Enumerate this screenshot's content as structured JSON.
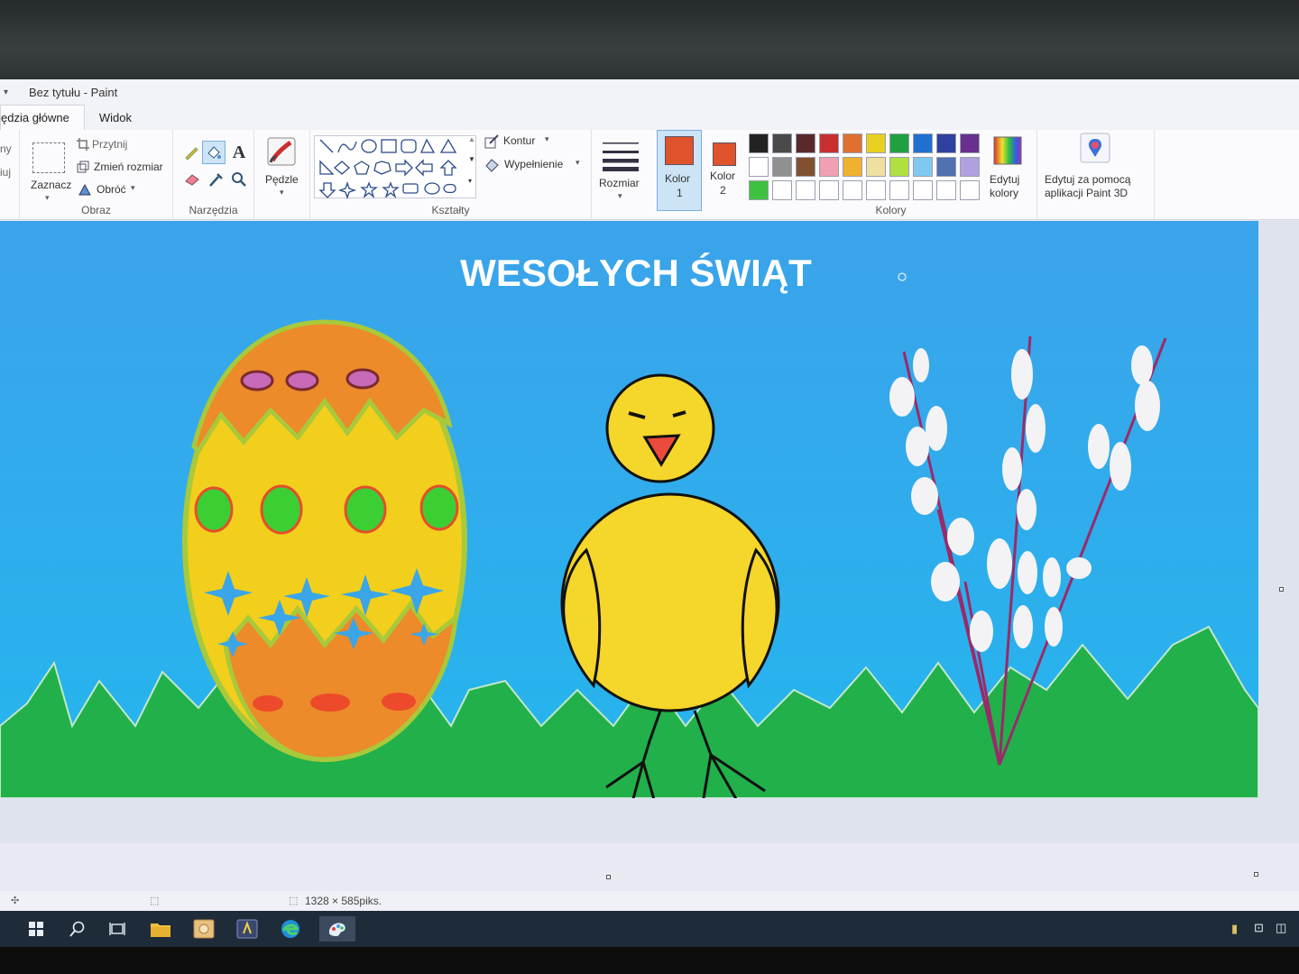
{
  "window": {
    "title": "Bez tytułu - Paint"
  },
  "tabs": [
    {
      "label": "ędzia główne"
    },
    {
      "label": "Widok"
    }
  ],
  "ribbon": {
    "left_partial": {
      "line1": "ny",
      "line2": "iuj"
    },
    "obraz": {
      "group_label": "Obraz",
      "select_label": "Zaznacz",
      "crop_label": "Przytnij",
      "resize_label": "Zmień rozmiar",
      "rotate_label": "Obróć"
    },
    "narzedzia": {
      "group_label": "Narzędzia",
      "text_tool_glyph": "A"
    },
    "brushes": {
      "label": "Pędzle"
    },
    "ksztalty": {
      "group_label": "Kształty",
      "outline_label": "Kontur",
      "fill_label": "Wypełnienie"
    },
    "size": {
      "label": "Rozmiar"
    },
    "color1": {
      "label": "Kolor",
      "number": "1",
      "value": "#e0522b"
    },
    "color2": {
      "label": "Kolor",
      "number": "2",
      "value": "#e0522b"
    },
    "kolory": {
      "group_label": "Kolory",
      "edit_label_1": "Edytuj",
      "edit_label_2": "kolory",
      "palette_row1": [
        "#222222",
        "#4a4a4a",
        "#5a2a2a",
        "#c83030",
        "#e07030",
        "#e8d020",
        "#20a040",
        "#2070d0",
        "#3040a0",
        "#6a3090"
      ],
      "palette_row2": [
        "#ffffff",
        "#909090",
        "#805030",
        "#f0a0b0",
        "#f0b030",
        "#f0e0a0",
        "#b0e040",
        "#80c8f0",
        "#5070b0",
        "#b0a0e0"
      ],
      "palette_row3": [
        "#40c040",
        "#ffffff",
        "#ffffff",
        "#ffffff",
        "#ffffff",
        "#ffffff",
        "#ffffff",
        "#ffffff",
        "#ffffff",
        "#ffffff"
      ]
    },
    "paint3d": {
      "line1": "Edytuj za pomocą",
      "line2": "aplikacji Paint 3D"
    }
  },
  "canvas": {
    "heading": "WESOŁYCH ŚWIĄT",
    "sky_color": "#34a6ec",
    "grass_color": "#22b04a"
  },
  "statusbar": {
    "size_text": "1328 × 585piks."
  },
  "taskbar": {
    "icons": [
      "windows-start-icon",
      "search-icon",
      "task-view-icon",
      "file-explorer-icon",
      "photos-icon",
      "app-icon",
      "edge-icon",
      "paint-icon"
    ]
  }
}
